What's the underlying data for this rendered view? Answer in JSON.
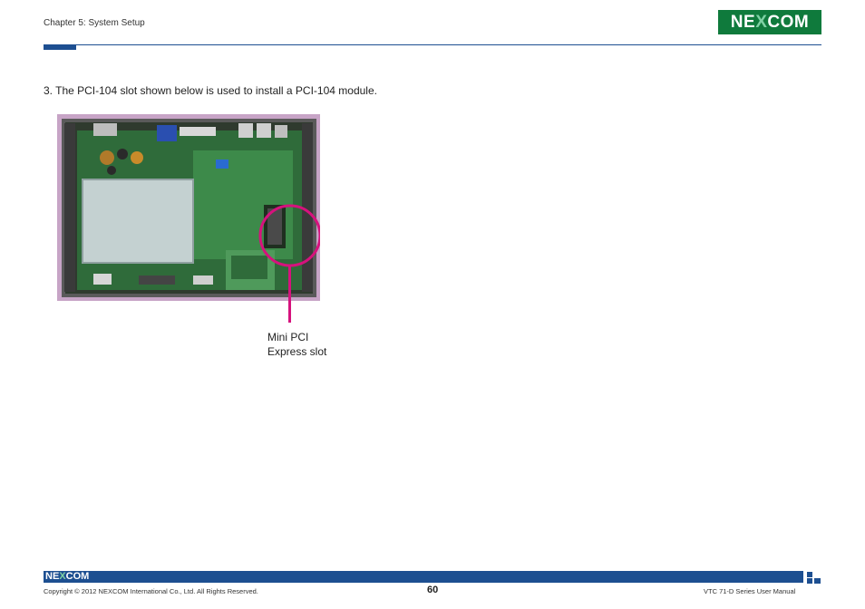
{
  "header": {
    "chapter": "Chapter 5: System Setup",
    "logo": {
      "part1": "NE",
      "part2": "X",
      "part3": "COM"
    }
  },
  "content": {
    "step_text": "3. The PCI-104 slot shown below is used to install a PCI-104 module.",
    "callout_line1": "Mini PCI",
    "callout_line2": "Express slot"
  },
  "footer": {
    "logo": {
      "part1": "NE",
      "part2": "X",
      "part3": "COM"
    },
    "copyright": "Copyright © 2012 NEXCOM International Co., Ltd. All Rights Reserved.",
    "page_number": "60",
    "manual_title": "VTC 71-D Series User Manual"
  },
  "colors": {
    "brand_blue": "#1d4f91",
    "logo_green": "#0f7a3c",
    "callout_magenta": "#d6127d"
  }
}
